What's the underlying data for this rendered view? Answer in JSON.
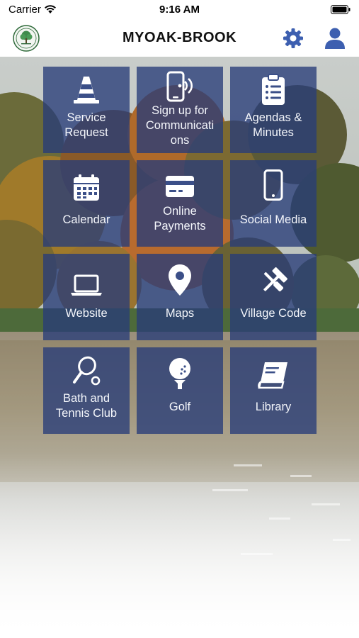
{
  "status_bar": {
    "carrier": "Carrier",
    "time": "9:16 AM"
  },
  "nav": {
    "title": "MYOAK-BROOK",
    "accent_color": "#3d5fb0"
  },
  "tiles": [
    {
      "label": "Service\nRequest",
      "icon": "traffic-cone-icon"
    },
    {
      "label": "Sign up for\nCommunicati\nons",
      "icon": "phone-signal-icon"
    },
    {
      "label": "Agendas &\nMinutes",
      "icon": "clipboard-icon"
    },
    {
      "label": "Calendar",
      "icon": "calendar-icon"
    },
    {
      "label": "Online\nPayments",
      "icon": "credit-card-icon"
    },
    {
      "label": "Social Media",
      "icon": "mobile-phone-icon"
    },
    {
      "label": "Website",
      "icon": "laptop-icon"
    },
    {
      "label": "Maps",
      "icon": "map-pin-icon"
    },
    {
      "label": "Village Code",
      "icon": "tools-icon"
    },
    {
      "label": "Bath and\nTennis Club",
      "icon": "tennis-racket-icon"
    },
    {
      "label": "Golf",
      "icon": "golf-ball-icon"
    },
    {
      "label": "Library",
      "icon": "book-icon"
    }
  ],
  "colors": {
    "tile_background": "#283c78",
    "tile_text": "#ffffff"
  }
}
